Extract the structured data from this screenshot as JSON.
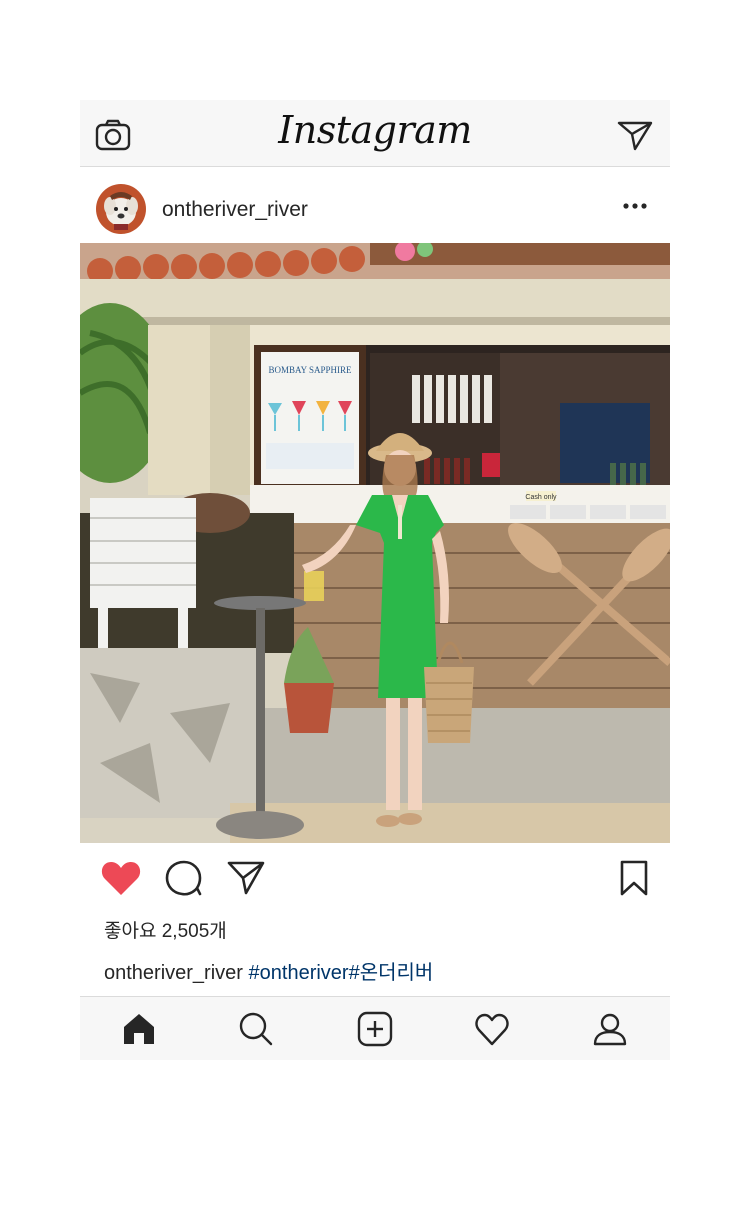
{
  "header": {
    "app_name": "Instagram",
    "left_icon": "camera-icon",
    "right_icon": "direct-message-icon"
  },
  "post": {
    "username": "ontheriver_river",
    "avatar_icon": "dog-avatar",
    "more_icon": "more-options-icon",
    "image": {
      "description_icon": "photo",
      "poster_text": "BOMBAY SAPPHIRE",
      "sign_text": "Cash only"
    },
    "actions": {
      "liked": true,
      "like_icon": "heart-filled-icon",
      "comment_icon": "comment-icon",
      "share_icon": "share-icon",
      "save_icon": "bookmark-icon"
    },
    "likes_text": "좋아요 2,505개",
    "caption": {
      "username": "ontheriver_river",
      "hashtags": "#ontheriver#온더리버"
    }
  },
  "bottom_nav": {
    "items": [
      {
        "icon": "home-icon",
        "active": true
      },
      {
        "icon": "search-icon",
        "active": false
      },
      {
        "icon": "new-post-icon",
        "active": false
      },
      {
        "icon": "activity-heart-icon",
        "active": false
      },
      {
        "icon": "profile-icon",
        "active": false
      }
    ]
  },
  "colors": {
    "like_red": "#ed4956",
    "hashtag_blue": "#003569",
    "bar_bg": "#f7f7f7",
    "dress_green": "#2bb84a"
  }
}
